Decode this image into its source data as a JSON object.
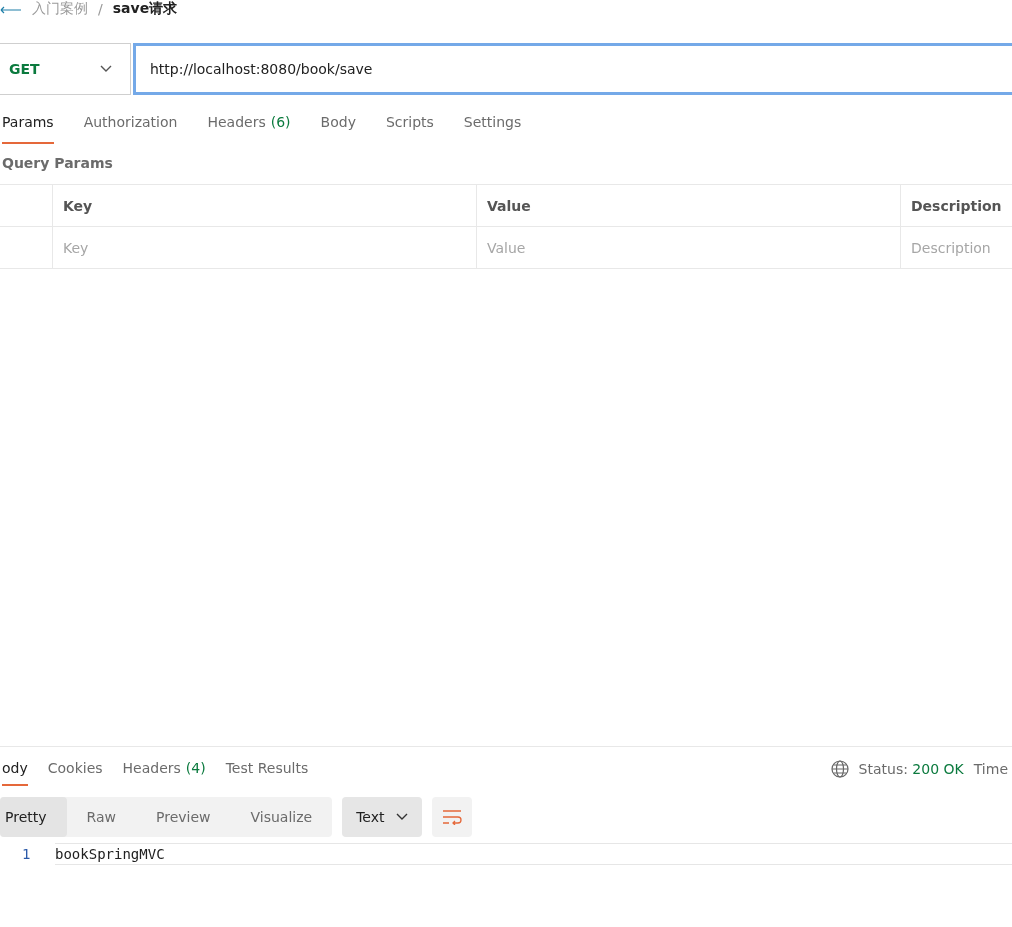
{
  "breadcrumb": {
    "parent": "入门案例",
    "separator": "/",
    "current": "save请求"
  },
  "request": {
    "method": "GET",
    "url": "http://localhost:8080/book/save"
  },
  "request_tabs": [
    {
      "label": "Params",
      "selected": true
    },
    {
      "label": "Authorization",
      "selected": false
    },
    {
      "label": "Headers",
      "count": "(6)",
      "selected": false
    },
    {
      "label": "Body",
      "selected": false
    },
    {
      "label": "Scripts",
      "selected": false
    },
    {
      "label": "Settings",
      "selected": false
    }
  ],
  "query_params": {
    "title": "Query Params",
    "columns": [
      "Key",
      "Value",
      "Description"
    ],
    "placeholders": [
      "Key",
      "Value",
      "Description"
    ]
  },
  "response_tabs": [
    {
      "label": "ody",
      "selected": true
    },
    {
      "label": "Cookies",
      "selected": false
    },
    {
      "label": "Headers",
      "count": "(4)",
      "selected": false
    },
    {
      "label": "Test Results",
      "selected": false
    }
  ],
  "status": {
    "label": "Status:",
    "value": "200 OK",
    "time_label": "Time"
  },
  "view_modes": [
    {
      "label": "Pretty",
      "selected": true
    },
    {
      "label": "Raw",
      "selected": false
    },
    {
      "label": "Preview",
      "selected": false
    },
    {
      "label": "Visualize",
      "selected": false
    }
  ],
  "format": "Text",
  "code_lines": [
    {
      "number": "1",
      "text": "bookSpringMVC"
    }
  ]
}
